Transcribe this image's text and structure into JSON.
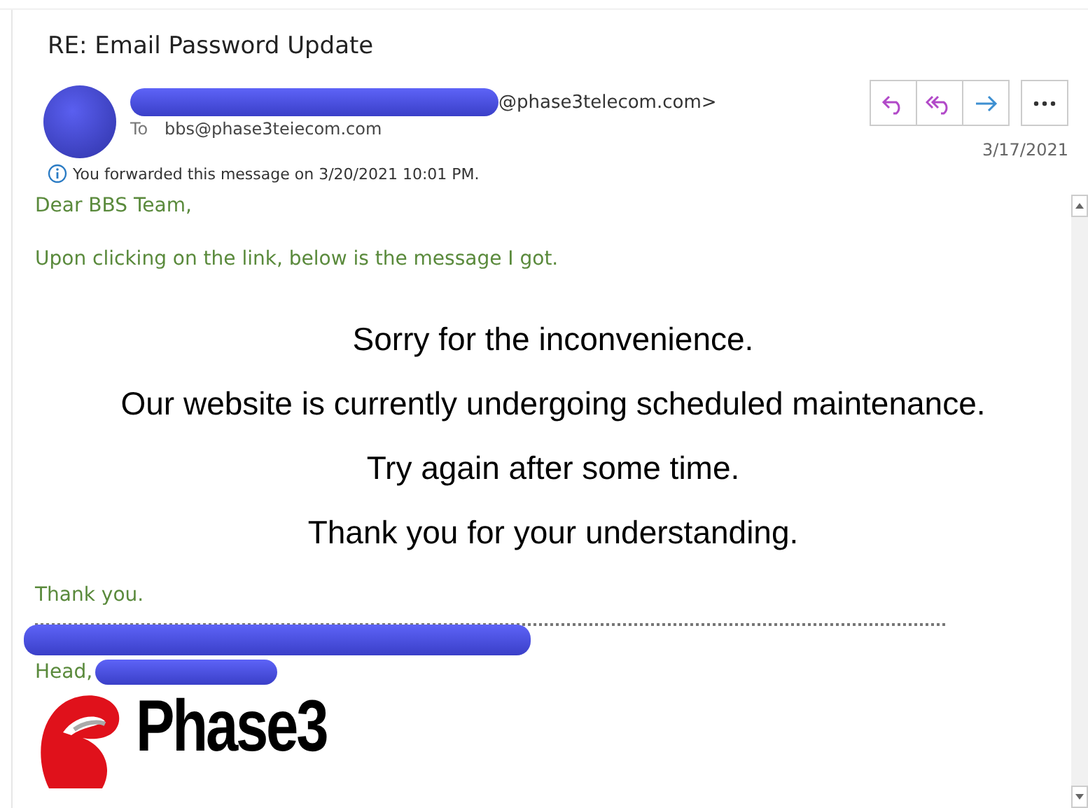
{
  "subject": "RE: Email Password Update",
  "sender": {
    "address_suffix": "@phase3telecom.com>",
    "to_label": "To",
    "to": "bbs@phase3teiecom.com",
    "date": "3/17/2021"
  },
  "actions": [
    {
      "kind": "reply"
    },
    {
      "kind": "reply-all"
    },
    {
      "kind": "forward"
    },
    {
      "kind": "more"
    }
  ],
  "info": "You forwarded this message on 3/20/2021 10:01 PM.",
  "body": {
    "greeting": "Dear BBS Team,",
    "intro": "Upon clicking on the link, below is the message I got.",
    "quoted": [
      "Sorry for the inconvenience.",
      "Our website is currently undergoing scheduled maintenance.",
      "Try again after some time.",
      "Thank you for your understanding."
    ],
    "closing": "Thank you.",
    "title_prefix": "Head,",
    "logo_text": "Phase3"
  }
}
